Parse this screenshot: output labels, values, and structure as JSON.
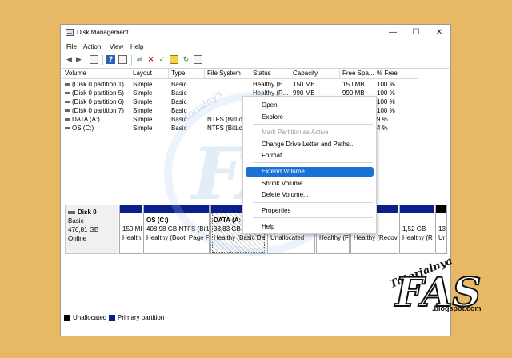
{
  "window": {
    "title": "Disk Management"
  },
  "window_buttons": {
    "minimize": "—",
    "maximize": "☐",
    "close": "✕"
  },
  "menu": [
    "File",
    "Action",
    "View",
    "Help"
  ],
  "toolbar_icons": [
    "back-icon",
    "forward-icon",
    "console-tree-icon",
    "help-icon",
    "properties-icon",
    "connect-icon",
    "delete-icon",
    "check-icon",
    "import-icon",
    "refresh-icon",
    "list-icon"
  ],
  "columns": [
    "Volume",
    "Layout",
    "Type",
    "File System",
    "Status",
    "Capacity",
    "Free Spa...",
    "% Free"
  ],
  "volumes": [
    [
      "(Disk 0 partition 1)",
      "Simple",
      "Basic",
      "",
      "Healthy (E...",
      "150 MB",
      "150 MB",
      "100 %"
    ],
    [
      "(Disk 0 partition 5)",
      "Simple",
      "Basic",
      "",
      "Healthy (R...",
      "990 MB",
      "990 MB",
      "100 %"
    ],
    [
      "(Disk 0 partition 6)",
      "Simple",
      "Basic",
      "",
      "",
      "",
      "",
      "100 %"
    ],
    [
      "(Disk 0 partition 7)",
      "Simple",
      "Basic",
      "",
      "",
      "",
      "",
      "100 %"
    ],
    [
      "DATA (A:)",
      "Simple",
      "Basic",
      "NTFS (BitLo...",
      "",
      "",
      "",
      "9 %"
    ],
    [
      "OS (C:)",
      "Simple",
      "Basic",
      "NTFS (BitLo...",
      "",
      "",
      "",
      "4 %"
    ]
  ],
  "disk": {
    "name": "Disk 0",
    "type": "Basic",
    "size": "476,81 GB",
    "status": "Online"
  },
  "partitions": [
    {
      "line1": "",
      "line2": "150 MI",
      "line3": "Health"
    },
    {
      "line1": "OS  (C:)",
      "line2": "408,98 GB NTFS (BitLo",
      "line3": "Healthy (Boot, Page F"
    },
    {
      "line1": "DATA  (A:",
      "line2": "38,83 GB N",
      "line3": "Healthy (Basic Da"
    },
    {
      "line1": "",
      "line2": "",
      "line3": "Unallocated"
    },
    {
      "line1": "",
      "line2": "",
      "line3": "Healthy (F"
    },
    {
      "line1": "",
      "line2": "",
      "line3": "Healthy (Recov"
    },
    {
      "line1": "",
      "line2": "1,52 GB",
      "line3": "Healthy (R"
    },
    {
      "line1": "",
      "line2": "13",
      "line3": "Ur"
    }
  ],
  "legend": {
    "unallocated": "Unallocated",
    "primary": "Primary partition"
  },
  "context_menu": [
    {
      "label": "Open",
      "disabled": false,
      "highlighted": false
    },
    {
      "label": "Explore",
      "disabled": false,
      "highlighted": false
    },
    {
      "label": "Mark Partition as Active",
      "disabled": true,
      "highlighted": false
    },
    {
      "label": "Change Drive Letter and Paths...",
      "disabled": false,
      "highlighted": false
    },
    {
      "label": "Format...",
      "disabled": false,
      "highlighted": false
    },
    {
      "label": "Extend Volume...",
      "disabled": false,
      "highlighted": true
    },
    {
      "label": "Shrink Volume...",
      "disabled": false,
      "highlighted": false
    },
    {
      "label": "Delete Volume...",
      "disabled": false,
      "highlighted": false
    },
    {
      "label": "Properties",
      "disabled": false,
      "highlighted": false
    },
    {
      "label": "Help",
      "disabled": false,
      "highlighted": false
    }
  ],
  "watermark": {
    "text1": "Tutorialnya",
    "text2": "FAS",
    "text3": ".blogspot.com"
  },
  "colors": {
    "primary_partition": "#0a1e8c",
    "unallocated": "#000000",
    "highlight": "#1a72d6",
    "background": "#E8B964"
  }
}
